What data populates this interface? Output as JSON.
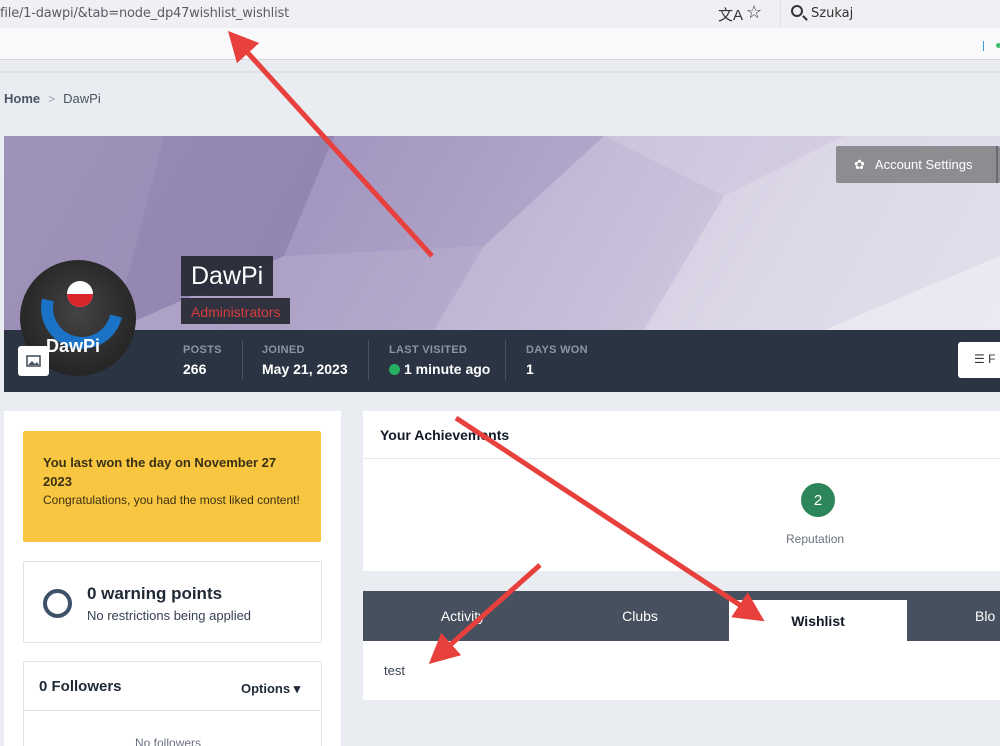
{
  "browser": {
    "url": "file/1-dawpi/&tab=node_dp47wishlist_wishlist",
    "search_placeholder": "Szukaj"
  },
  "breadcrumb": {
    "home": "Home",
    "separator": ">",
    "current": "DawPi"
  },
  "profile": {
    "name": "DawPi",
    "group": "Administrators",
    "avatar_text": "DawPi",
    "account_settings_label": "Account Settings",
    "stats": [
      {
        "label": "POSTS",
        "value": "266"
      },
      {
        "label": "JOINED",
        "value": "May 21, 2023"
      },
      {
        "label": "LAST VISITED",
        "value": "1 minute ago"
      },
      {
        "label": "DAYS WON",
        "value": "1"
      }
    ],
    "right_button_label": "F"
  },
  "sidebar": {
    "day_won_title": "You last won the day on November 27 2023",
    "day_won_sub": "Congratulations, you had the most liked content!",
    "warning_title": "0 warning points",
    "warning_sub": "No restrictions being applied",
    "followers_title": "0 Followers",
    "options_label": "Options",
    "no_followers": "No followers"
  },
  "achievements": {
    "title": "Your Achievements",
    "reputation_value": "2",
    "reputation_label": "Reputation"
  },
  "tabs": [
    {
      "label": "Activity",
      "active": false
    },
    {
      "label": "Clubs",
      "active": false
    },
    {
      "label": "Wishlist",
      "active": true
    },
    {
      "label": "Blo",
      "active": false
    }
  ],
  "tab_content": "test",
  "colors": {
    "annotation_arrow": "#e8403c",
    "stats_bar": "#2b3442",
    "day_box": "#f9c641",
    "group_text": "#d63c3c"
  }
}
